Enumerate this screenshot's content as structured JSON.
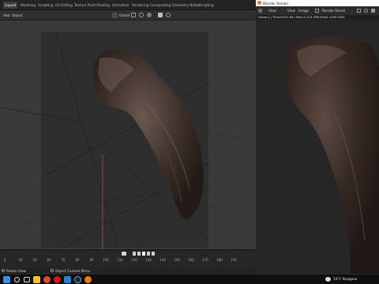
{
  "workspace_tabs": [
    "Layout",
    "Modeling",
    "Sculpting",
    "UV Editing",
    "Texture Paint",
    "Shading",
    "Animation",
    "Rendering",
    "Compositing",
    "Geometry Nodes",
    "Scripting"
  ],
  "active_tab": "Layout",
  "header": {
    "menu_add": "Add",
    "menu_object": "Object",
    "transform_orientation": "Global"
  },
  "timeline": {
    "ticks": [
      "0",
      "40",
      "50",
      "60",
      "70",
      "80",
      "90",
      "100",
      "110",
      "120",
      "130",
      "140",
      "150",
      "160",
      "170",
      "180",
      "190"
    ]
  },
  "statusbar": {
    "left": "Rotate View",
    "right": "Object Context Menu"
  },
  "render_window": {
    "title": "Blender Render",
    "menu_view": "View",
    "menu_view2": "View",
    "menu_image": "Image",
    "slot": "Render Result",
    "info": "Frame:1 | Time:00:02.84 | Mem:1,210.79M (Peak: 1295.52M)"
  },
  "taskbar": {
    "weather": "14°C  Nuageux"
  },
  "colors": {
    "accent_blue": "#2e7dd6",
    "active_tab_bg": "#3d3d3d",
    "hair_dark": "#2a1f1b",
    "hair_light": "#6b5850"
  },
  "icons": {
    "taskbar": [
      "windows-icon",
      "search-icon",
      "task-view-icon",
      "explorer-icon",
      "chrome-icon",
      "opera-icon",
      "store-icon",
      "steam-icon",
      "blender-icon"
    ]
  }
}
